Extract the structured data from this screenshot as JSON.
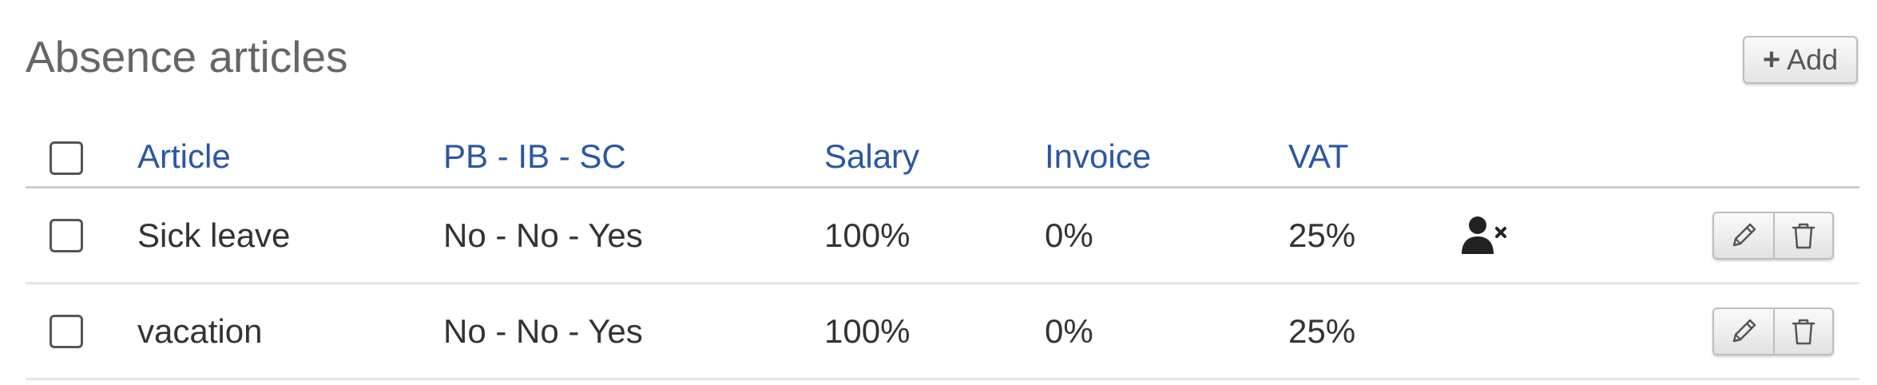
{
  "page": {
    "title": "Absence articles",
    "add_button_label": "Add",
    "add_button_plus": "+"
  },
  "table": {
    "columns": [
      "Article",
      "PB - IB - SC",
      "Salary",
      "Invoice",
      "VAT"
    ],
    "rows": [
      {
        "article": "Sick leave",
        "pb_ib_sc": "No - No - Yes",
        "salary": "100%",
        "invoice": "0%",
        "vat": "25%",
        "icon": "person-x-icon"
      },
      {
        "article": "vacation",
        "pb_ib_sc": "No - No - Yes",
        "salary": "100%",
        "invoice": "0%",
        "vat": "25%",
        "icon": ""
      }
    ]
  },
  "icons": {
    "edit": "pencil-icon",
    "delete": "trash-icon"
  },
  "colors": {
    "header_link": "#2a56a4",
    "title_gray": "#666666",
    "text": "#333333"
  }
}
